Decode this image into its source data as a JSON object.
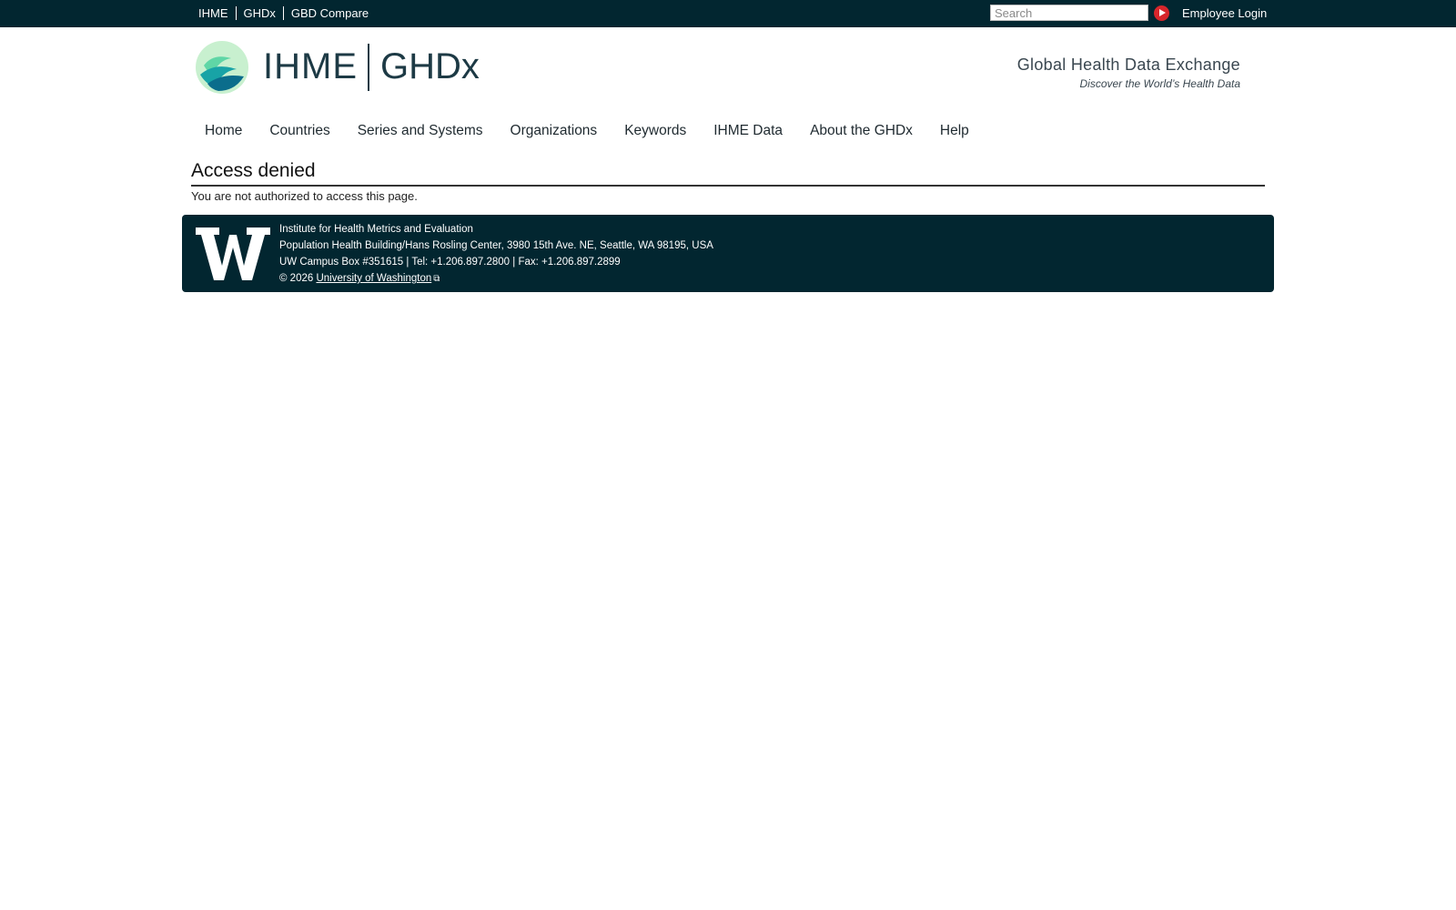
{
  "topbar": {
    "links": [
      "IHME",
      "GHDx",
      "GBD Compare"
    ],
    "search_placeholder": "Search",
    "login_label": "Employee Login"
  },
  "header": {
    "brand_left": "IHME",
    "brand_right": "GHDx",
    "tagline": "Global Health Data Exchange",
    "subtagline": "Discover the World’s Health Data"
  },
  "nav": {
    "items": [
      "Home",
      "Countries",
      "Series and Systems",
      "Organizations",
      "Keywords",
      "IHME Data",
      "About the GHDx",
      "Help"
    ]
  },
  "main": {
    "title": "Access denied",
    "message": "You are not authorized to access this page."
  },
  "footer": {
    "org": "Institute for Health Metrics and Evaluation",
    "address": "Population Health Building/Hans Rosling Center, 3980 15th Ave. NE, Seattle, WA 98195, USA",
    "contact": "UW Campus Box #351615 | Tel: +1.206.897.2800 | Fax: +1.206.897.2899",
    "copyright_prefix": "© 2026",
    "uw_link": "University of Washington"
  },
  "colors": {
    "dark_bar": "#022630",
    "accent_red": "#d8262b",
    "brand_text": "#1d3a45"
  },
  "icons": [
    "search-go-icon",
    "ihme-logo-icon",
    "uw-logo-icon",
    "external-link-icon"
  ]
}
